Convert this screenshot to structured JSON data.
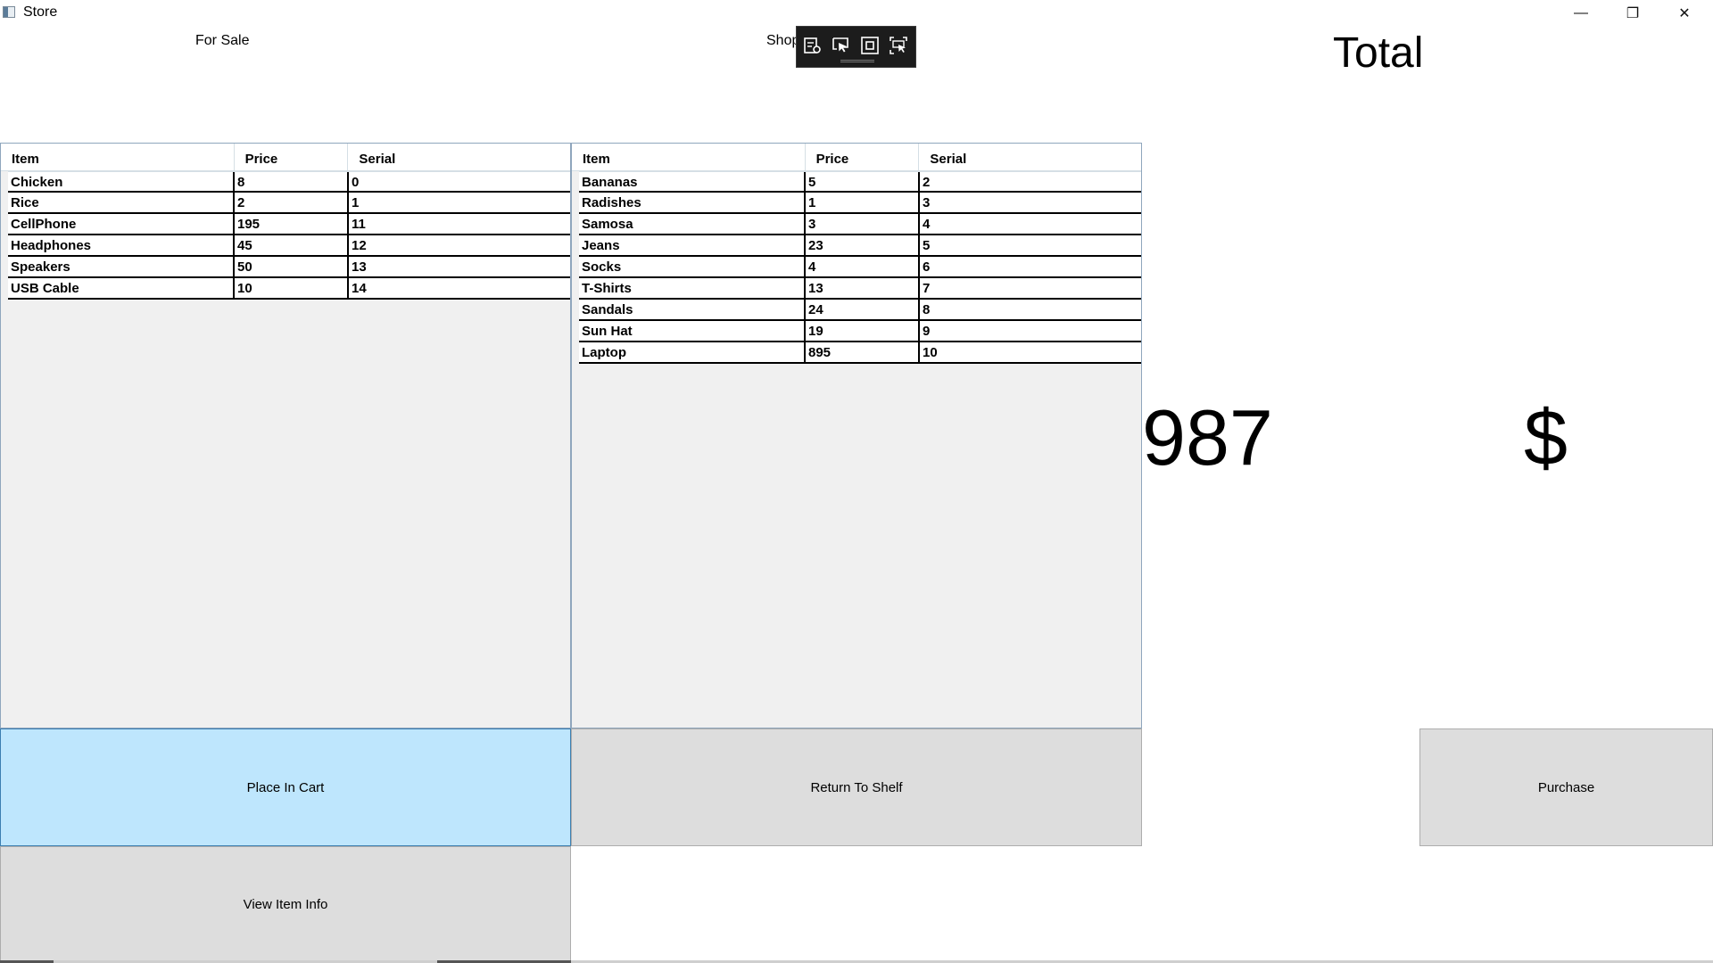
{
  "window": {
    "title": "Store",
    "minimize_glyph": "—",
    "restore_glyph": "❐",
    "close_glyph": "✕"
  },
  "labels": {
    "for_sale": "For Sale",
    "shop": "Shop",
    "total": "Total"
  },
  "toolbar": {
    "icons": [
      "settings-icon",
      "select-pointer-icon",
      "rectangle-capture-icon",
      "region-capture-icon"
    ]
  },
  "for_sale_grid": {
    "columns": [
      "Item",
      "Price",
      "Serial"
    ],
    "rows": [
      [
        "Chicken",
        "8",
        "0"
      ],
      [
        "Rice",
        "2",
        "1"
      ],
      [
        "CellPhone",
        "195",
        "11"
      ],
      [
        "Headphones",
        "45",
        "12"
      ],
      [
        "Speakers",
        "50",
        "13"
      ],
      [
        "USB Cable",
        "10",
        "14"
      ]
    ]
  },
  "cart_grid": {
    "columns": [
      "Item",
      "Price",
      "Serial"
    ],
    "rows": [
      [
        "Bananas",
        "5",
        "2"
      ],
      [
        "Radishes",
        "1",
        "3"
      ],
      [
        "Samosa",
        "3",
        "4"
      ],
      [
        "Jeans",
        "23",
        "5"
      ],
      [
        "Socks",
        "4",
        "6"
      ],
      [
        "T-Shirts",
        "13",
        "7"
      ],
      [
        "Sandals",
        "24",
        "8"
      ],
      [
        "Sun Hat",
        "19",
        "9"
      ],
      [
        "Laptop",
        "895",
        "10"
      ]
    ]
  },
  "total": {
    "amount": "987",
    "currency": "$"
  },
  "buttons": {
    "place_in_cart": "Place In Cart",
    "return_to_shelf": "Return To Shelf",
    "purchase": "Purchase",
    "view_item_info": "View Item Info"
  },
  "colors": {
    "active_button": "#bee6fd",
    "button": "#dddddd",
    "grid_background": "#f0f0f0"
  }
}
